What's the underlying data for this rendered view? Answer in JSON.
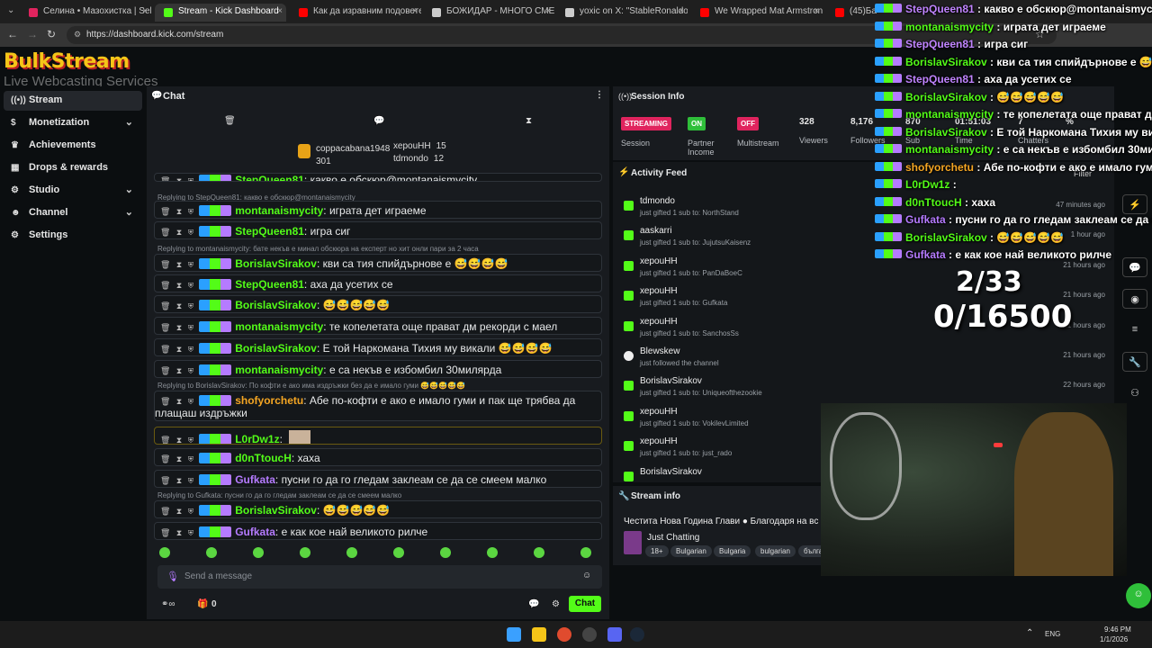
{
  "browser": {
    "tabs": [
      {
        "label": "Селина • Мазохистка | Selina",
        "color": "#e0245e"
      },
      {
        "label": "Stream - Kick Dashboard",
        "color": "#53fc18",
        "active": true
      },
      {
        "label": "Как да изравним подовете у д",
        "color": "#ff0000"
      },
      {
        "label": "БОЖИДАР - МНОГО СМЕШНИ",
        "color": "#cccccc"
      },
      {
        "label": "yoxic on X: \"StableRonaldo just",
        "color": "#cccccc"
      },
      {
        "label": "We Wrapped Mat Armstrong's",
        "color": "#ff0000"
      },
      {
        "label": "(45)Бай Иво",
        "color": "#ff0000"
      }
    ],
    "url": "https://dashboard.kick.com/stream"
  },
  "logo": {
    "line1": "BulkStream",
    "line2": "Live Webcasting Services"
  },
  "sidebar": {
    "items": [
      {
        "label": "Stream",
        "icon": "stream-icon",
        "glyph": "((•))",
        "active": true
      },
      {
        "label": "Monetization",
        "icon": "dollar-icon",
        "glyph": "$",
        "chevron": true
      },
      {
        "label": "Achievements",
        "icon": "trophy-icon",
        "glyph": "♛"
      },
      {
        "label": "Drops & rewards",
        "icon": "gift-icon",
        "glyph": "▦"
      },
      {
        "label": "Studio",
        "icon": "gear-icon",
        "glyph": "⚙",
        "chevron": true
      },
      {
        "label": "Channel",
        "icon": "user-icon",
        "glyph": "☻",
        "chevron": true
      },
      {
        "label": "Settings",
        "icon": "settings-icon",
        "glyph": "⚙"
      }
    ]
  },
  "chat": {
    "title": "Chat",
    "top_gifters": [
      {
        "name": "coppacabana1948",
        "count": "301"
      },
      {
        "name": "херouHH",
        "count": "15"
      },
      {
        "name": "tdmondo",
        "count": "12"
      }
    ],
    "messages": [
      {
        "user": "StepQueen81",
        "color": "#53fc18",
        "text": "какво е обскюр@montanaismycity",
        "partial": true
      },
      {
        "user": "montanaismycity",
        "color": "#53fc18",
        "text": "играта дет играеме",
        "reply": "Replying to StepQueen81: какво е обскюр@montanaismycity"
      },
      {
        "user": "StepQueen81",
        "color": "#53fc18",
        "text": "игра сиг"
      },
      {
        "user": "BorislavSirakov",
        "color": "#53fc18",
        "text": "кви са тия спийдърнове е 😅😅😅😅",
        "reply": "Replying to montanaismycity: бате некъв е минал обскюра на експерт но хит онли пари за 2 часа"
      },
      {
        "user": "StepQueen81",
        "color": "#53fc18",
        "text": "аха да усетих се"
      },
      {
        "user": "BorislavSirakov",
        "color": "#53fc18",
        "text": "😅😅😅😅😅"
      },
      {
        "user": "montanaismycity",
        "color": "#53fc18",
        "text": "те копелетата още прават дм рекорди с маел"
      },
      {
        "user": "BorislavSirakov",
        "color": "#53fc18",
        "text": "Е той Наркомана Тихия му викали 😅😅😅😅"
      },
      {
        "user": "montanaismycity",
        "color": "#53fc18",
        "text": "е са некъв е избомбил 30милярда"
      },
      {
        "user": "shofyorchetu",
        "color": "#f5a623",
        "text": "Абе по-кофти е ако е имало гуми и пак ще трябва да плащаш издръжки",
        "reply": "Replying to BorislavSirakov: По кофти е ако има издръжки без да е имало гуми 😅😅😅😅😅"
      },
      {
        "user": "L0rDw1z",
        "color": "#53fc18",
        "text": ""
      },
      {
        "user": "d0nTtoucH",
        "color": "#53fc18",
        "text": "хаха"
      },
      {
        "user": "Gufkata",
        "color": "#b57bff",
        "text": "пусни го да го гледам заклеам се да се смеем малко"
      },
      {
        "user": "BorislavSirakov",
        "color": "#53fc18",
        "text": "😅😅😅😅😅",
        "reply": "Replying to Gufkata: пусни го да го гледам заклеам се да се смеем малко"
      },
      {
        "user": "Gufkata",
        "color": "#b57bff",
        "text": "е как кое най великото рилче"
      }
    ],
    "input_placeholder": "Send a message",
    "gift_count": "0",
    "chat_button": "Chat"
  },
  "session": {
    "title": "Session Info",
    "badges": [
      {
        "label": "STREAMING",
        "sub": "Session",
        "color": "#e0245e"
      },
      {
        "label": "ON",
        "sub": "Partner Income",
        "color": "#2fbf3a"
      },
      {
        "label": "OFF",
        "sub": "Multistream",
        "color": "#e0245e"
      }
    ],
    "stats": [
      {
        "value": "328",
        "label": "Viewers"
      },
      {
        "value": "8,176",
        "label": "Followers"
      },
      {
        "value": "870",
        "label": "Sub"
      },
      {
        "value": "01:51:03",
        "label": "Time"
      },
      {
        "value": "7",
        "label": "Chatters"
      },
      {
        "value": "%",
        "label": ""
      }
    ]
  },
  "activity": {
    "title": "Activity Feed",
    "filter": "Filter",
    "items": [
      {
        "name": "tdmondo",
        "desc": "just gifted 1 sub to: NorthStand",
        "time": "47 minutes ago"
      },
      {
        "name": "aaskarri",
        "desc": "just gifted 1 sub to: JujutsuKaisenz",
        "time": "1 hour ago"
      },
      {
        "name": "херouHH",
        "desc": "just gifted 1 sub to: PanDaBoeC",
        "time": "21 hours ago"
      },
      {
        "name": "херouHH",
        "desc": "just gifted 1 sub to: Gufkata",
        "time": "21 hours ago"
      },
      {
        "name": "херouHH",
        "desc": "just gifted 1 sub to: SanchosSs",
        "time": "21 hours ago"
      },
      {
        "name": "Blewskew",
        "desc": "just followed the channel",
        "time": "21 hours ago",
        "follow": true
      },
      {
        "name": "BorislavSirakov",
        "desc": "just gifted 1 sub to: Uniqueofthezookie",
        "time": "22 hours ago"
      },
      {
        "name": "херouHH",
        "desc": "just gifted 1 sub to: VokilevLimited",
        "time": "21 hours ago"
      },
      {
        "name": "херouHH",
        "desc": "just gifted 1 sub to: just_rado",
        "time": "21 hours ago"
      },
      {
        "name": "BorislavSirakov",
        "desc": "",
        "time": ""
      }
    ]
  },
  "stream_info": {
    "title": "Stream info",
    "stream_title": "Честита Нова Година Глави ● Благодаря на вс",
    "category": "Just Chatting",
    "tags": [
      "18+",
      "Bulgarian",
      "Bulgaria",
      "bulgarian",
      "бълга"
    ]
  },
  "overlay": {
    "lines": [
      {
        "user": "StepQueen81",
        "text": "какво е обскюр@montanaismycity"
      },
      {
        "user": "montanaismycity",
        "text": "играта дет играеме"
      },
      {
        "user": "StepQueen81",
        "text": "игра сиг"
      },
      {
        "user": "BorislavSirakov",
        "text": "кви са тия спийдърнове е 😅😅😅😅"
      },
      {
        "user": "StepQueen81",
        "text": "аха да усетих се"
      },
      {
        "user": "BorislavSirakov",
        "text": "😅😅😅😅😅"
      },
      {
        "user": "montanaismycity",
        "text": "те копелетата още прават дм рекорди"
      },
      {
        "user": "BorislavSirakov",
        "text": "Е той Наркомана Тихия му викали 😅"
      },
      {
        "user": "montanaismycity",
        "text": "е са некъв е избомбил 30милярда"
      },
      {
        "user": "shofyorchetu",
        "text": "Абе по-кофти е ако е имало гуми и пак ще"
      },
      {
        "user": "L0rDw1z",
        "text": ""
      },
      {
        "user": "d0nTtoucH",
        "text": "хаха"
      },
      {
        "user": "Gufkata",
        "text": "пусни го да го гледам заклеам се да се смеем"
      },
      {
        "user": "BorislavSirakov",
        "text": "😅😅😅😅😅"
      },
      {
        "user": "Gufkata",
        "text": "е как кое най великото рилче"
      }
    ],
    "counter_subs": "2/33",
    "counter_goal": "0/16500"
  },
  "taskbar": {
    "lang": "ENG",
    "time": "9:46 PM",
    "date": "1/1/2026"
  }
}
